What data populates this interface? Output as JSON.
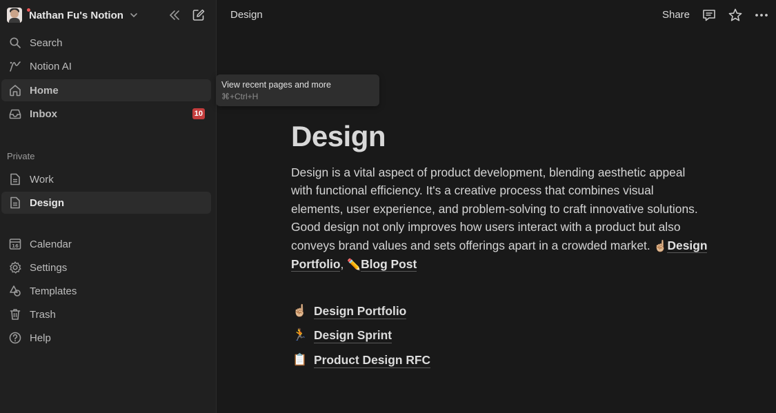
{
  "workspace": {
    "name": "Nathan Fu's Notion"
  },
  "sidebar": {
    "top_items": [
      {
        "label": "Search",
        "icon": "search-icon"
      },
      {
        "label": "Notion AI",
        "icon": "notion-ai-icon"
      },
      {
        "label": "Home",
        "icon": "home-icon",
        "active": true
      },
      {
        "label": "Inbox",
        "icon": "inbox-icon",
        "badge": "10"
      }
    ],
    "section_label": "Private",
    "private_pages": [
      {
        "label": "Work",
        "icon": "page-icon"
      },
      {
        "label": "Design",
        "icon": "page-icon",
        "active": true
      }
    ],
    "bottom_items": [
      {
        "label": "Calendar",
        "icon": "calendar-icon"
      },
      {
        "label": "Settings",
        "icon": "settings-icon"
      },
      {
        "label": "Templates",
        "icon": "templates-icon"
      },
      {
        "label": "Trash",
        "icon": "trash-icon"
      },
      {
        "label": "Help",
        "icon": "help-icon"
      }
    ]
  },
  "tooltip": {
    "title": "View recent pages and more",
    "shortcut": "⌘+Ctrl+H"
  },
  "header": {
    "breadcrumb": "Design",
    "share_label": "Share"
  },
  "page": {
    "title": "Design",
    "description": "Design is a vital aspect of product development, blending aesthetic appeal with functional efficiency. It's a creative process that combines visual elements, user experience, and problem-solving to craft innovative solutions. Good design not only improves how users interact with a product but also conveys brand values and sets offerings apart in a crowded market. ",
    "inline_links": [
      {
        "emoji": "☝🏼",
        "label": "Design Portfolio"
      },
      {
        "emoji": "✏️",
        "label": "Blog Post"
      }
    ],
    "link_separator": ", ",
    "sub_pages": [
      {
        "emoji": "☝🏼",
        "label": "Design Portfolio"
      },
      {
        "emoji": "🏃",
        "label": "Design Sprint"
      },
      {
        "emoji": "📋",
        "label": "Product Design RFC"
      }
    ]
  },
  "colors": {
    "sidebar_bg": "#202020",
    "main_bg": "#191919",
    "active_bg": "#2c2c2c",
    "badge_bg": "#c43d3d"
  }
}
